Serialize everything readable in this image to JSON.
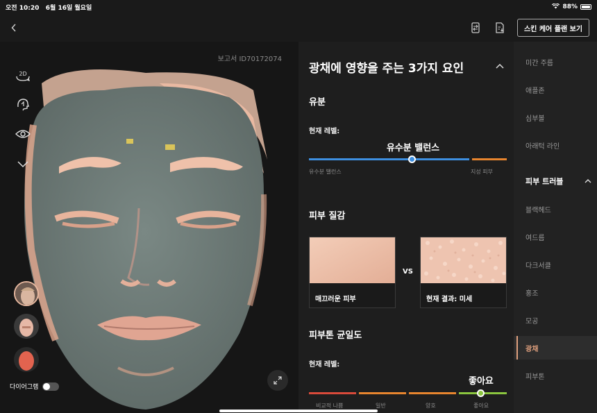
{
  "status": {
    "time": "오전 10:20",
    "date": "6월 16일 월요일",
    "battery": "88%"
  },
  "topnav": {
    "plan_button": "스킨 케어 플랜 보기"
  },
  "face": {
    "report_id": "보고서 ID70172074",
    "tool_2d": "2D",
    "diagram_label": "다이어그램"
  },
  "analysis": {
    "title": "광채에 영향을 주는 3가지 요인",
    "oil": {
      "heading": "유분",
      "level_label": "현재 레벨:",
      "level_value": "유수분 밸런스",
      "left_axis": "유수분 밸런스",
      "right_axis": "지성 피부",
      "position": 0.52
    },
    "texture": {
      "heading": "피부 질감",
      "smooth_caption": "매끄러운 피부",
      "vs": "VS",
      "current_caption": "현재 결과: 미세"
    },
    "tone": {
      "heading": "피부톤 균일도",
      "level_label": "현재 레벨:",
      "level_value": "좋아요",
      "axis": [
        "비교적 나쁨",
        "일반",
        "양호",
        "좋아요"
      ],
      "position": 0.87
    }
  },
  "colors": {
    "accent": "#e0a07e",
    "blue": "#3d8fe0",
    "orange": "#e8852e",
    "red": "#d94a3a",
    "green": "#8bc63f"
  },
  "sidebar": {
    "items": [
      {
        "label": "미간 주름"
      },
      {
        "label": "애플존"
      },
      {
        "label": "심부볼"
      },
      {
        "label": "아래턱 라인"
      },
      {
        "label": "피부 트러블"
      },
      {
        "label": "블랙헤드"
      },
      {
        "label": "여드름"
      },
      {
        "label": "다크서클"
      },
      {
        "label": "홍조"
      },
      {
        "label": "모공"
      },
      {
        "label": "광채"
      },
      {
        "label": "피부톤"
      }
    ]
  }
}
